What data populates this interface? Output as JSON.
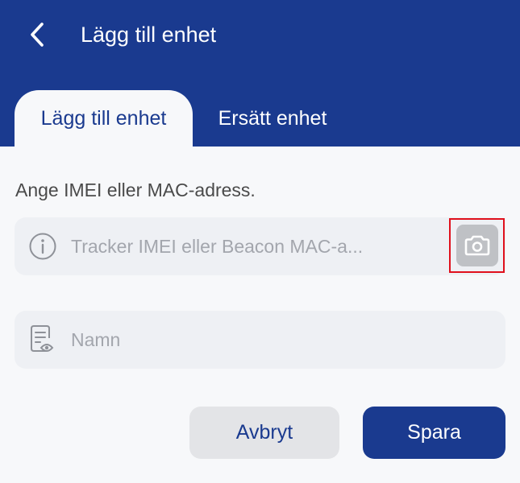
{
  "header": {
    "title": "Lägg till enhet",
    "back_icon": "chevron-left-icon"
  },
  "tabs": [
    {
      "label": "Lägg till enhet",
      "active": true
    },
    {
      "label": "Ersätt enhet",
      "active": false
    }
  ],
  "form": {
    "instruction": "Ange IMEI eller MAC-adress.",
    "imei_field": {
      "placeholder": "Tracker IMEI eller Beacon MAC-a...",
      "value": "",
      "icon": "info-icon",
      "scan_icon": "camera-icon"
    },
    "name_field": {
      "placeholder": "Namn",
      "value": "",
      "icon": "document-view-icon"
    }
  },
  "actions": {
    "cancel_label": "Avbryt",
    "save_label": "Spara"
  },
  "colors": {
    "primary": "#1a3a8f",
    "background": "#f7f8fa",
    "field_background": "#eef0f4",
    "highlight": "#e0101c"
  }
}
